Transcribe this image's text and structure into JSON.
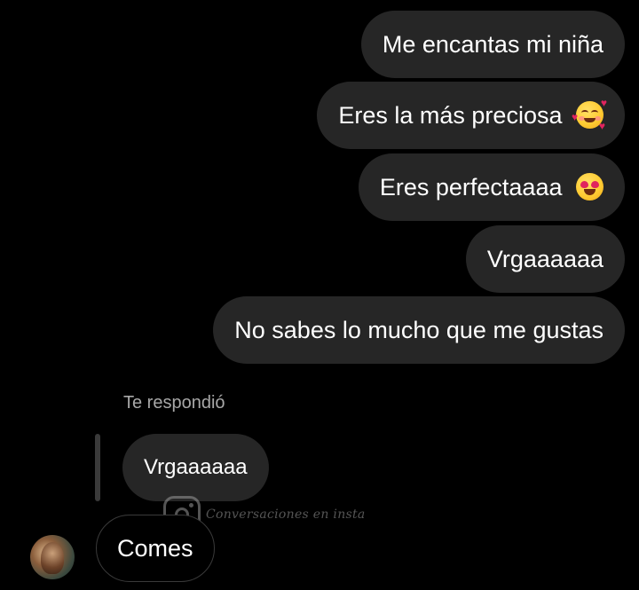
{
  "messages_sent": [
    {
      "text": "Me encantas mi niña",
      "emoji": ""
    },
    {
      "text": "Eres la más preciosa",
      "emoji": "smiling-face-with-hearts"
    },
    {
      "text": "Eres perfectaaaa",
      "emoji": "heart-eyes"
    },
    {
      "text": "Vrgaaaaaa",
      "emoji": ""
    },
    {
      "text": "No sabes lo mucho que me gustas",
      "emoji": ""
    }
  ],
  "reply": {
    "label": "Te respondió",
    "quoted_text": "Vrgaaaaaa",
    "message_text": "Comes"
  },
  "avatar": {
    "icon": "contact-avatar"
  },
  "watermark": {
    "icon": "instagram-icon",
    "text": "Conversaciones en insta"
  },
  "colors": {
    "background": "#000000",
    "bubble": "#262626",
    "text": "#ffffff",
    "muted_text": "#a8a8a8"
  }
}
